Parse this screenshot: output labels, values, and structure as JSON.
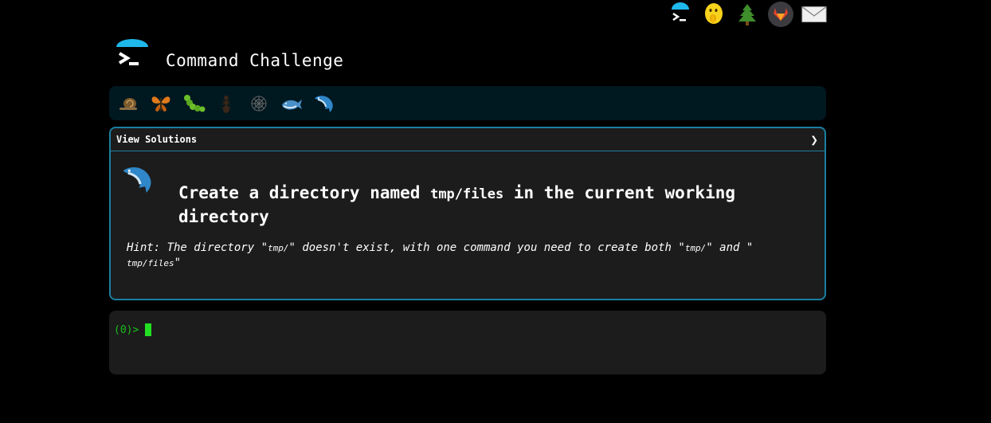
{
  "app": {
    "title": "Command Challenge"
  },
  "top_icons": [
    {
      "name": "cmdchallenge-icon"
    },
    {
      "name": "shush-face-icon"
    },
    {
      "name": "tree-icon"
    },
    {
      "name": "gitlab-icon"
    },
    {
      "name": "mail-icon"
    }
  ],
  "levels": [
    {
      "name": "snail-icon"
    },
    {
      "name": "butterfly-icon"
    },
    {
      "name": "caterpillar-icon"
    },
    {
      "name": "ant-icon"
    },
    {
      "name": "spider-web-icon"
    },
    {
      "name": "whale-icon"
    },
    {
      "name": "dolphin-icon"
    }
  ],
  "challenge": {
    "view_solutions": "View Solutions",
    "chevron": "❯",
    "question_before": "Create a directory named ",
    "question_code": "tmp/files",
    "question_after": " in the current working directory",
    "hint_1": "Hint: The directory \"",
    "hint_code_1": "tmp/",
    "hint_2": "\" doesn't exist, with one command you need to create both \"",
    "hint_code_2": "tmp/",
    "hint_3": "\" and \"",
    "hint_code_3": "tmp/files",
    "hint_4": "\""
  },
  "terminal": {
    "prompt": "(0)>",
    "input_value": ""
  },
  "colors": {
    "accent": "#1a7fa0",
    "prompt_green": "#18c018",
    "cursor_green": "#22e022",
    "level_bar_bg": "#001820",
    "card_bg": "#1c1c1c"
  }
}
